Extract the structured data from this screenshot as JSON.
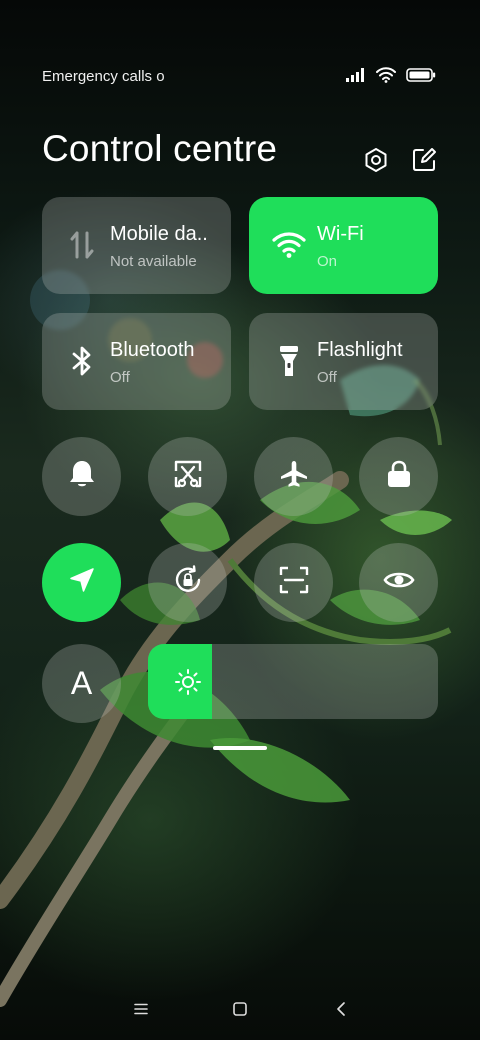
{
  "status_bar": {
    "carrier_text": "Emergency calls o",
    "icons": [
      "signal-icon",
      "wifi-icon",
      "battery-icon"
    ]
  },
  "header": {
    "title": "Control centre",
    "icons": [
      "settings-icon",
      "edit-icon"
    ]
  },
  "tiles": [
    {
      "label": "Mobile da..",
      "status": "Not available",
      "icon": "mobile-data-icon",
      "active": false
    },
    {
      "label": "Wi-Fi",
      "status": "On",
      "icon": "wifi-icon",
      "active": true
    },
    {
      "label": "Bluetooth",
      "status": "Off",
      "icon": "bluetooth-icon",
      "active": false
    },
    {
      "label": "Flashlight",
      "status": "Off",
      "icon": "flashlight-icon",
      "active": false
    }
  ],
  "toggles": [
    {
      "icon": "bell-icon",
      "active": false
    },
    {
      "icon": "screenshot-icon",
      "active": false
    },
    {
      "icon": "airplane-icon",
      "active": false
    },
    {
      "icon": "lock-icon",
      "active": false
    },
    {
      "icon": "location-icon",
      "active": true
    },
    {
      "icon": "rotation-lock-icon",
      "active": false
    },
    {
      "icon": "scanner-icon",
      "active": false
    },
    {
      "icon": "eye-icon",
      "active": false
    },
    {
      "icon": "font-icon",
      "active": false,
      "text": "A"
    }
  ],
  "brightness": {
    "level": 0.22,
    "icon": "sun-icon"
  },
  "nav_bar": {
    "icons": [
      "menu-icon",
      "home-icon",
      "back-icon"
    ]
  },
  "colors": {
    "accent": "#1fde5a",
    "tile_bg": "rgba(190,195,190,0.28)"
  }
}
